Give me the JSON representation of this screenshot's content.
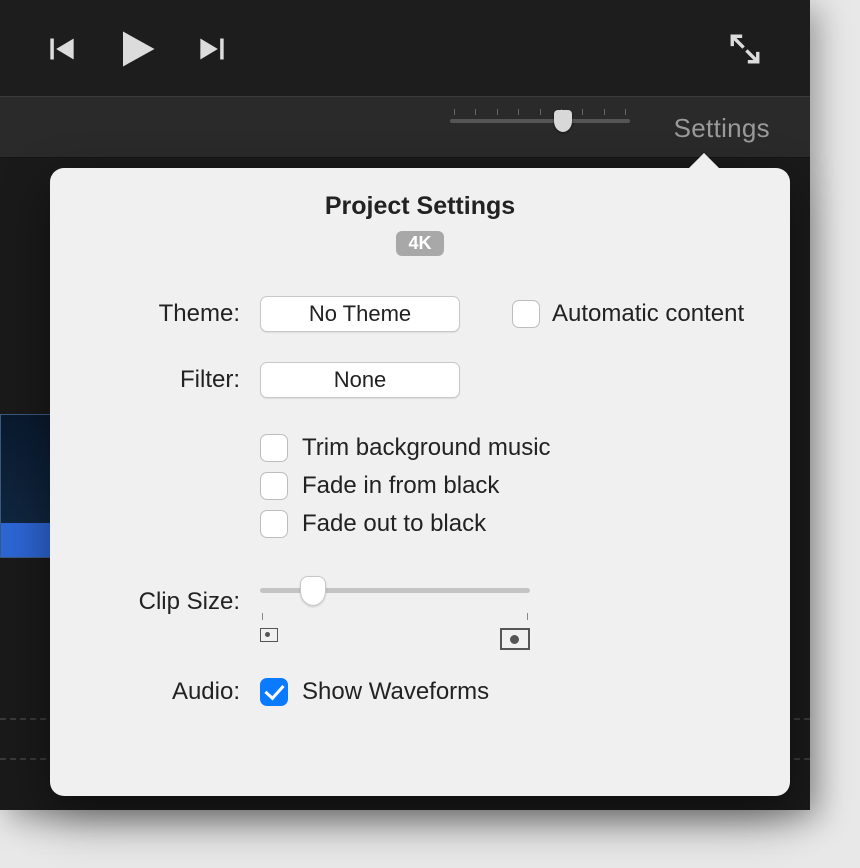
{
  "toolbar": {
    "settings_label": "Settings"
  },
  "popover": {
    "title": "Project Settings",
    "badge": "4K",
    "theme_label": "Theme:",
    "theme_value": "No Theme",
    "automatic_content_label": "Automatic content",
    "filter_label": "Filter:",
    "filter_value": "None",
    "trim_label": "Trim background music",
    "fade_in_label": "Fade in from black",
    "fade_out_label": "Fade out to black",
    "clip_size_label": "Clip Size:",
    "audio_label": "Audio:",
    "show_waveforms_label": "Show Waveforms"
  },
  "state": {
    "automatic_content_checked": false,
    "trim_checked": false,
    "fade_in_checked": false,
    "fade_out_checked": false,
    "show_waveforms_checked": true
  }
}
